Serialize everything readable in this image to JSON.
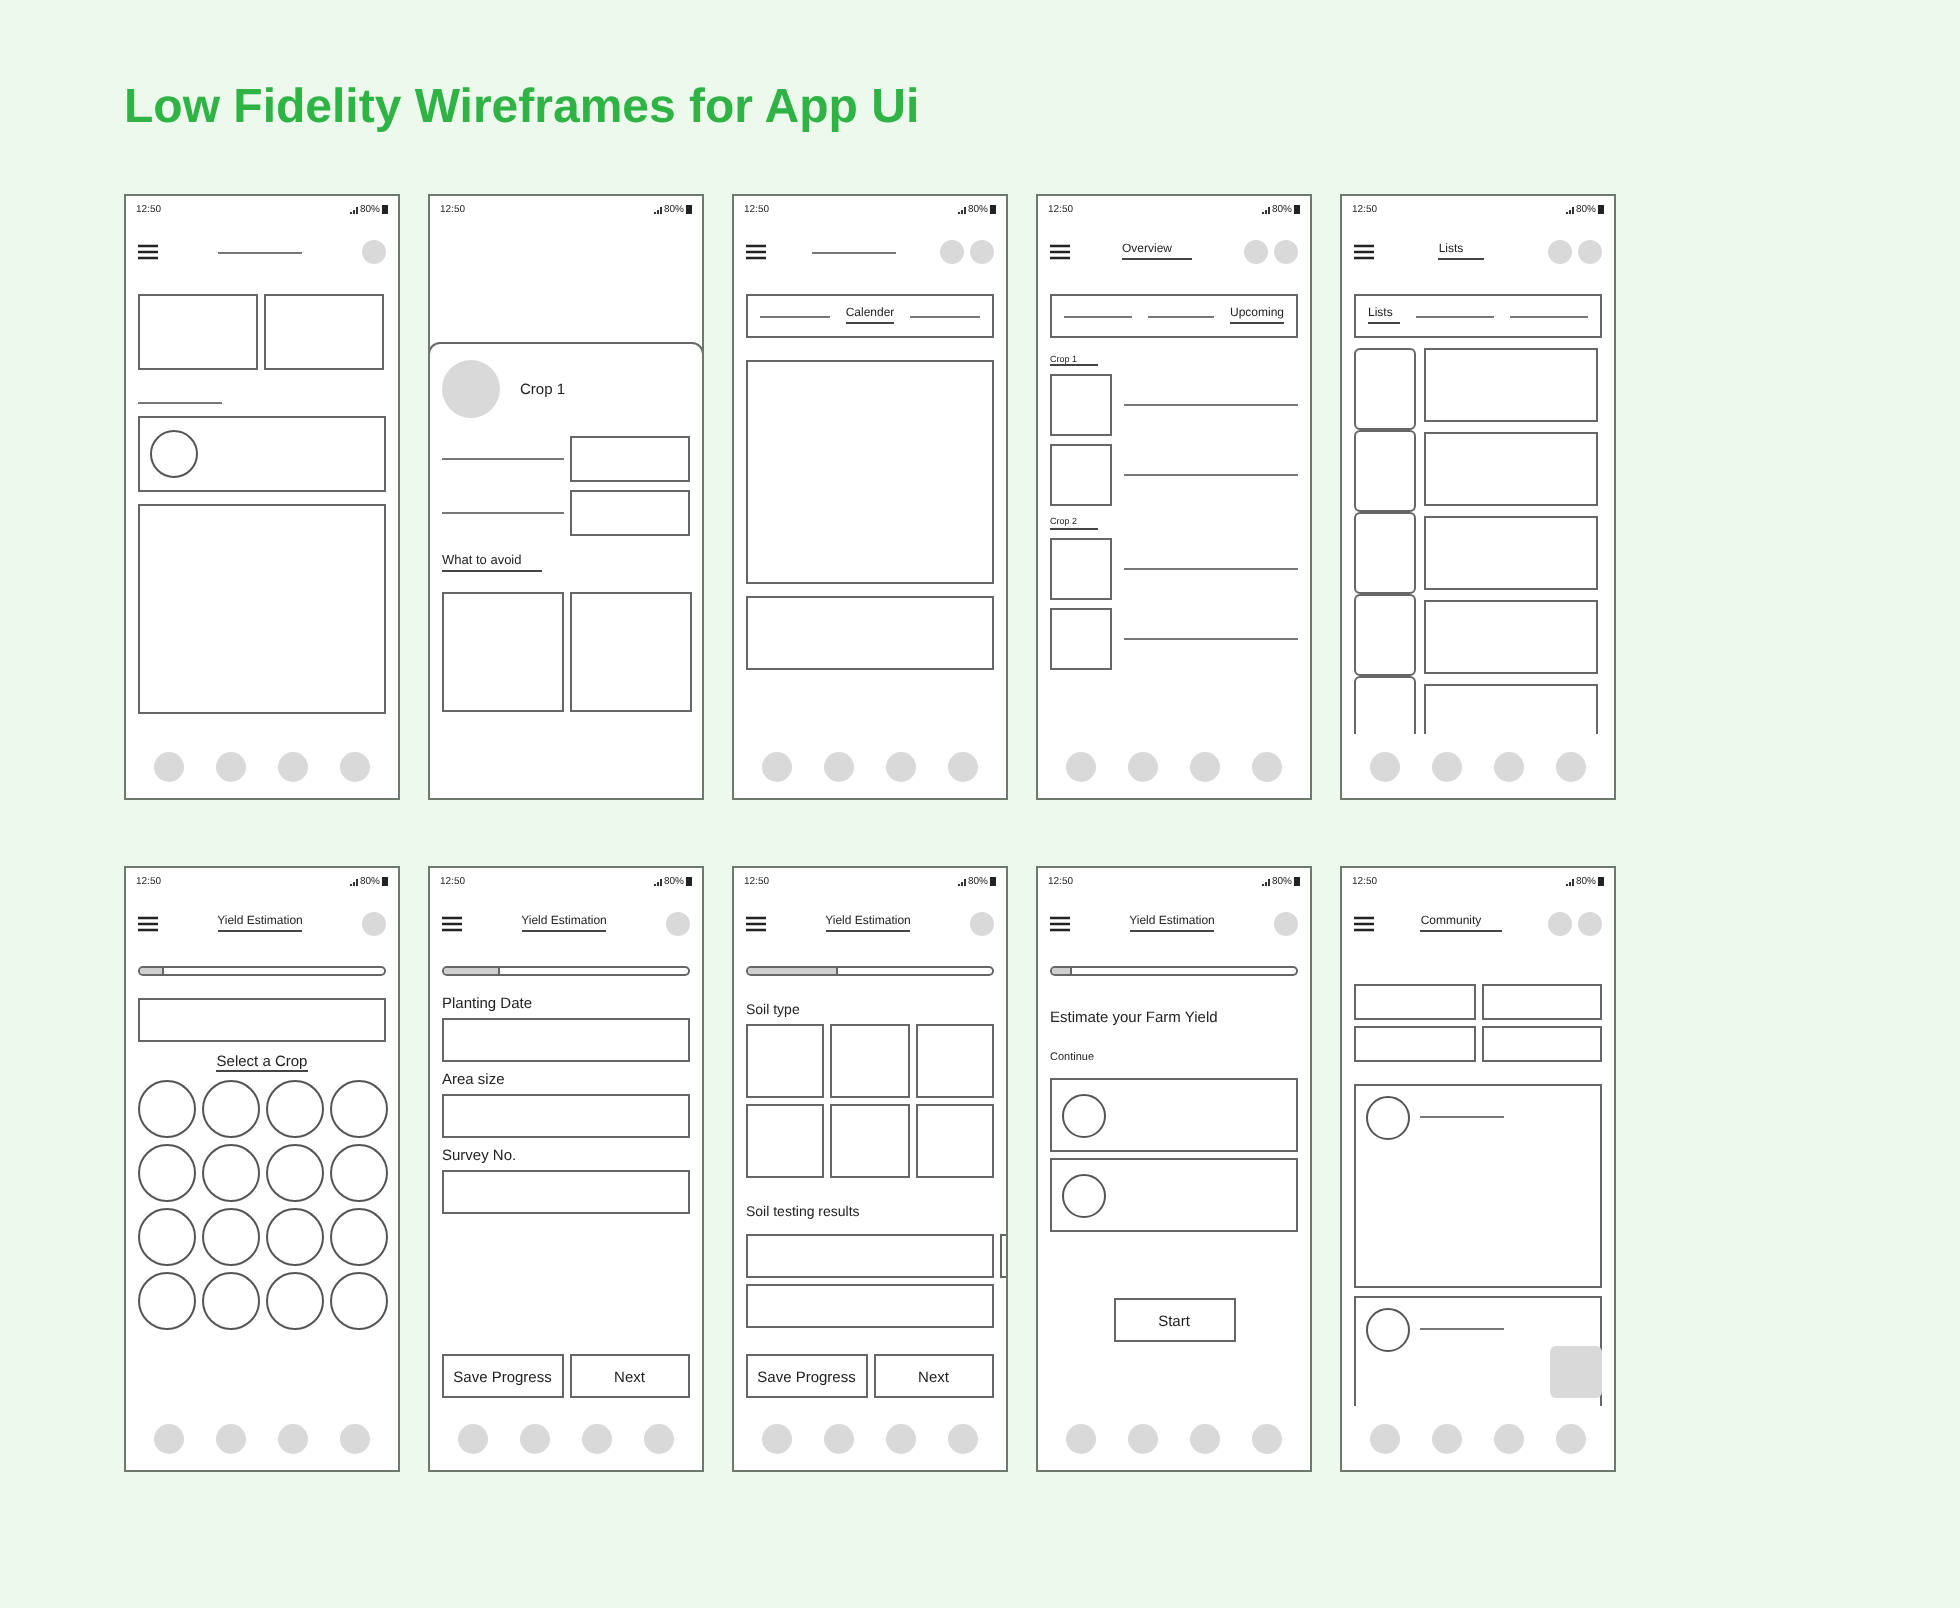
{
  "title": "Low Fidelity Wireframes for App Ui",
  "screens": [
    {
      "kind": "home",
      "status": {
        "time": "12:50",
        "battery": "80%"
      }
    },
    {
      "kind": "crop_detail",
      "status": {
        "time": "12:50",
        "battery": "80%"
      },
      "crop_name": "Crop 1",
      "section": "What to avoid"
    },
    {
      "kind": "calendar",
      "status": {
        "time": "12:50",
        "battery": "80%"
      },
      "tab": "Calender"
    },
    {
      "kind": "overview",
      "status": {
        "time": "12:50",
        "battery": "80%"
      },
      "title": "Overview",
      "tab": "Upcoming",
      "groups": [
        "Crop 1",
        "Crop 2"
      ]
    },
    {
      "kind": "lists",
      "status": {
        "time": "12:50",
        "battery": "80%"
      },
      "title": "Lists",
      "tab": "Lists"
    },
    {
      "kind": "select_crop",
      "status": {
        "time": "12:50",
        "battery": "80%"
      },
      "title": "Yield Estimation",
      "progress": {
        "level": 0.1
      },
      "prompt": "Select a Crop"
    },
    {
      "kind": "form",
      "status": {
        "time": "12:50",
        "battery": "80%"
      },
      "title": "Yield Estimation",
      "progress": {
        "level": 0.23
      },
      "fields": [
        "Planting Date",
        "Area size",
        "Survey No."
      ],
      "buttons": [
        "Save Progress",
        "Next"
      ]
    },
    {
      "kind": "soil",
      "status": {
        "time": "12:50",
        "battery": "80%"
      },
      "title": "Yield Estimation",
      "progress": {
        "level": 0.37
      },
      "soil_label": "Soil type",
      "results_label": "Soil testing results",
      "buttons": [
        "Save Progress",
        "Next"
      ]
    },
    {
      "kind": "start",
      "status": {
        "time": "12:50",
        "battery": "80%"
      },
      "title": "Yield Estimation",
      "progress": {
        "level": 0.08
      },
      "heading": "Estimate your Farm Yield",
      "subheading": "Continue",
      "button": "Start"
    },
    {
      "kind": "community",
      "status": {
        "time": "12:50",
        "battery": "80%"
      },
      "title": "Community"
    }
  ]
}
